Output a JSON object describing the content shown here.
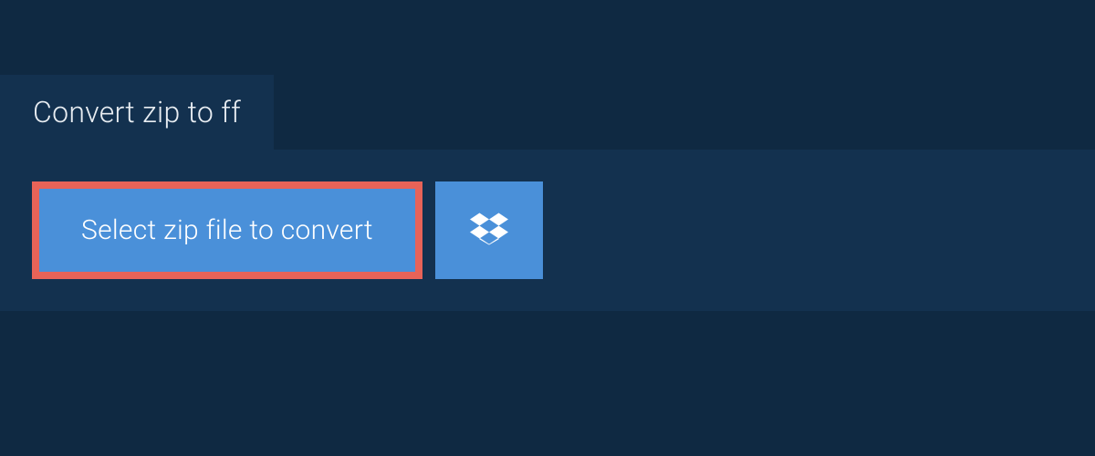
{
  "header": {
    "title": "Convert zip to ff"
  },
  "upload": {
    "select_button_label": "Select zip file to convert",
    "dropbox_icon": "dropbox-icon"
  },
  "colors": {
    "background": "#0f2942",
    "panel": "#13314f",
    "button": "#4a90d9",
    "highlight_border": "#e76358",
    "text_light": "#e8edf2",
    "text_white": "#ffffff"
  }
}
